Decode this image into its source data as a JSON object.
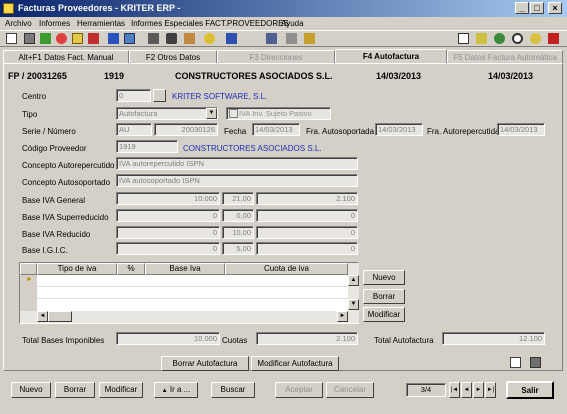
{
  "window": {
    "title": "Facturas Proveedores - KRITER ERP -"
  },
  "menu": [
    "Archivo",
    "Informes",
    "Herramientas",
    "Informes Especiales FACT.PROVEEDORES",
    "Ayuda"
  ],
  "tabs": [
    {
      "label": "Alt+F1 Datos Fact. Manual",
      "state": "normal"
    },
    {
      "label": "F2 Otros Datos",
      "state": "normal"
    },
    {
      "label": "F3 Direcciones",
      "state": "disabled"
    },
    {
      "label": "F4 Autofactura",
      "state": "active"
    },
    {
      "label": "F5 Datos Factura Automática",
      "state": "disabled"
    }
  ],
  "header": {
    "doc": "FP / 20031265",
    "code": "1919",
    "name": "CONSTRUCTORES ASOCIADOS S.L.",
    "date1": "14/03/2013",
    "date2": "14/03/2013"
  },
  "form": {
    "centro": {
      "label": "Centro",
      "value": "0",
      "desc": "KRITER SOFTWARE, S.L."
    },
    "tipo": {
      "label": "Tipo",
      "value": "Autofactura",
      "iva_checkbox": "IVA Inv. Sujeto Pasivo"
    },
    "serie": {
      "label": "Serie / Número",
      "serie": "AU",
      "numero": "20030126",
      "fecha_label": "Fecha",
      "fecha": "14/03/2013",
      "fra_auto_label": "Fra. Autosoportada",
      "fra_auto": "14/03/2013",
      "fra_reperc_label": "Fra. Autorepercutida",
      "fra_reperc": "14/03/2013"
    },
    "proveedor": {
      "label": "Código Proveedor",
      "value": "1919",
      "desc": "CONSTRUCTORES ASOCIADOS S.L."
    },
    "concepto_rep": {
      "label": "Concepto Autorepercutido",
      "value": "IVA autorepercutido ISPN"
    },
    "concepto_sop": {
      "label": "Concepto Autosoportado",
      "value": "IVA autosoportado ISPN"
    },
    "bases": [
      {
        "label": "Base IVA General",
        "base": "10.000",
        "pct": "21,00",
        "cuota": "2.100"
      },
      {
        "label": "Base IVA Superreducido",
        "base": "0",
        "pct": "0,00",
        "cuota": "0"
      },
      {
        "label": "Base IVA Reducido",
        "base": "0",
        "pct": "10,00",
        "cuota": "0"
      },
      {
        "label": "Base I.G.I.C.",
        "base": "0",
        "pct": "5,00",
        "cuota": "0"
      }
    ]
  },
  "grid": {
    "columns": [
      "Tipo de iva",
      "%",
      "Base Iva",
      "Cuota de iva"
    ],
    "side_buttons": [
      "Nuevo",
      "Borrar",
      "Modificar"
    ]
  },
  "totals": {
    "bases_label": "Total Bases Imponibles",
    "bases": "10.000",
    "cuotas_label": "Cuotas",
    "cuotas": "2.100",
    "auto_label": "Total Autofactura",
    "auto": "12.100"
  },
  "panel_buttons": [
    "Borrar Autofactura",
    "Modificar Autofactura"
  ],
  "bottom": {
    "nuevo": "Nuevo",
    "borrar": "Borrar",
    "modificar": "Modificar",
    "ira": "Ir a ...",
    "buscar": "Buscar",
    "aceptar": "Aceptar",
    "cancelar": "Cancelar",
    "pager": "3/4",
    "salir": "Salir"
  },
  "colors": {
    "titlebar_start": "#0a246a",
    "titlebar_end": "#a6caf0",
    "link_blue": "#1c2fb8",
    "face": "#d4d0c8"
  }
}
